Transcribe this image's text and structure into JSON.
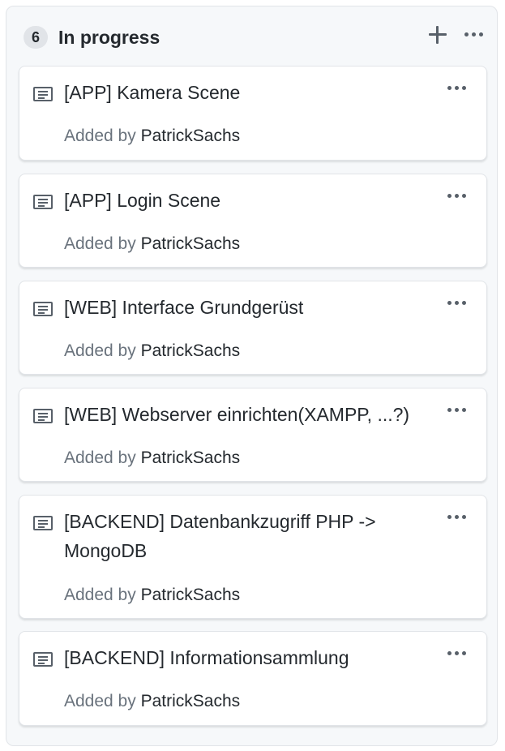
{
  "column": {
    "count": "6",
    "title": "In progress",
    "add_icon": "plus-icon",
    "menu_icon": "kebab-horizontal-icon"
  },
  "cards": [
    {
      "title": "[APP] Kamera Scene",
      "added_by_label": "Added by",
      "author": "PatrickSachs",
      "icon": "note-icon"
    },
    {
      "title": "[APP] Login Scene",
      "added_by_label": "Added by",
      "author": "PatrickSachs",
      "icon": "note-icon"
    },
    {
      "title": "[WEB] Interface Grundgerüst",
      "added_by_label": "Added by",
      "author": "PatrickSachs",
      "icon": "note-icon"
    },
    {
      "title": "[WEB] Webserver einrichten(XAMPP, ...?)",
      "added_by_label": "Added by",
      "author": "PatrickSachs",
      "icon": "note-icon"
    },
    {
      "title": "[BACKEND] Datenbankzugriff PHP -> MongoDB",
      "added_by_label": "Added by",
      "author": "PatrickSachs",
      "icon": "note-icon"
    },
    {
      "title": "[BACKEND] Informationsammlung",
      "added_by_label": "Added by",
      "author": "PatrickSachs",
      "icon": "note-icon"
    }
  ],
  "colors": {
    "column_bg": "#f6f8fa",
    "card_bg": "#ffffff",
    "muted_text": "#6a737d",
    "text": "#24292e",
    "icon": "#586069"
  }
}
